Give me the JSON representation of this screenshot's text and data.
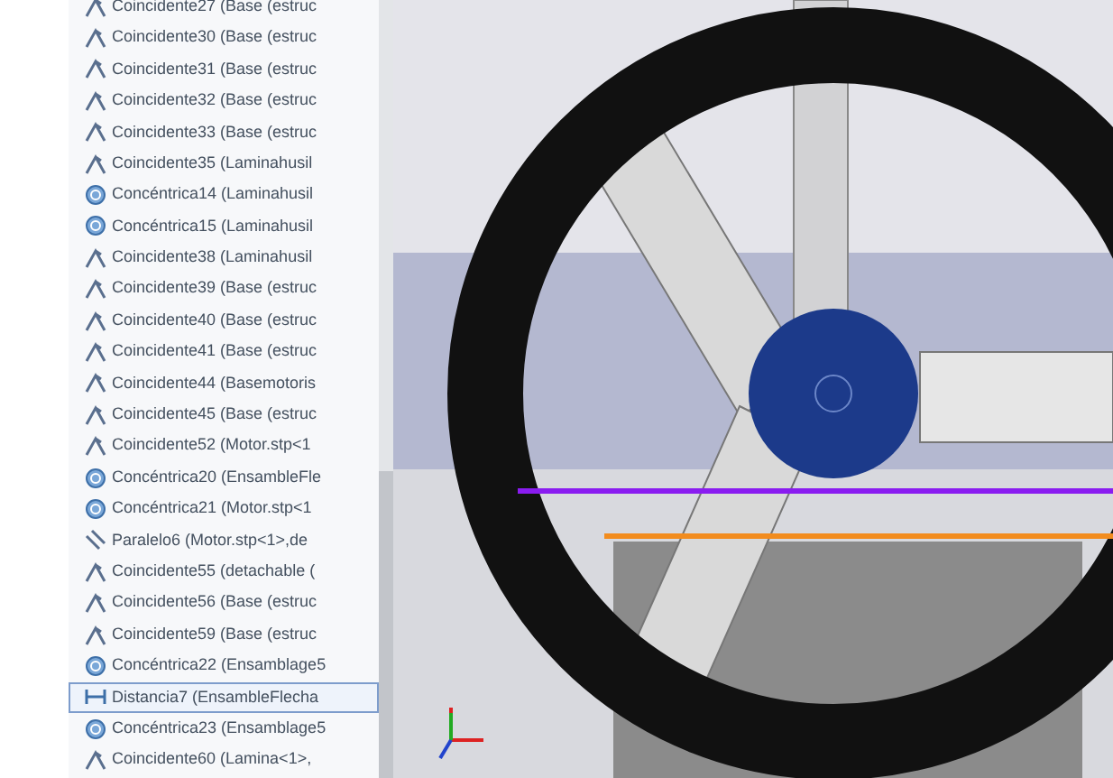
{
  "tree": {
    "items": [
      {
        "kind": "coincident",
        "label": "Coincidente27 (Base (estruc",
        "selected": false
      },
      {
        "kind": "coincident",
        "label": "Coincidente30 (Base (estruc",
        "selected": false
      },
      {
        "kind": "coincident",
        "label": "Coincidente31 (Base (estruc",
        "selected": false
      },
      {
        "kind": "coincident",
        "label": "Coincidente32 (Base (estruc",
        "selected": false
      },
      {
        "kind": "coincident",
        "label": "Coincidente33 (Base (estruc",
        "selected": false
      },
      {
        "kind": "coincident",
        "label": "Coincidente35 (Laminahusil",
        "selected": false
      },
      {
        "kind": "concentric",
        "label": "Concéntrica14 (Laminahusil",
        "selected": false
      },
      {
        "kind": "concentric",
        "label": "Concéntrica15 (Laminahusil",
        "selected": false
      },
      {
        "kind": "coincident",
        "label": "Coincidente38 (Laminahusil",
        "selected": false
      },
      {
        "kind": "coincident",
        "label": "Coincidente39 (Base (estruc",
        "selected": false
      },
      {
        "kind": "coincident",
        "label": "Coincidente40 (Base (estruc",
        "selected": false
      },
      {
        "kind": "coincident",
        "label": "Coincidente41 (Base (estruc",
        "selected": false
      },
      {
        "kind": "coincident",
        "label": "Coincidente44 (Basemotoris",
        "selected": false
      },
      {
        "kind": "coincident",
        "label": "Coincidente45 (Base (estruc",
        "selected": false
      },
      {
        "kind": "coincident",
        "label": "Coincidente52 (Motor.stp<1",
        "selected": false
      },
      {
        "kind": "concentric",
        "label": "Concéntrica20 (EnsambleFle",
        "selected": false
      },
      {
        "kind": "concentric",
        "label": "Concéntrica21 (Motor.stp<1",
        "selected": false
      },
      {
        "kind": "parallel",
        "label": "Paralelo6 (Motor.stp<1>,de",
        "selected": false
      },
      {
        "kind": "coincident",
        "label": "Coincidente55 (detachable (",
        "selected": false
      },
      {
        "kind": "coincident",
        "label": "Coincidente56 (Base (estruc",
        "selected": false
      },
      {
        "kind": "coincident",
        "label": "Coincidente59 (Base (estruc",
        "selected": false
      },
      {
        "kind": "concentric",
        "label": "Concéntrica22 (Ensamblage5",
        "selected": false
      },
      {
        "kind": "distance",
        "label": "Distancia7 (EnsambleFlecha",
        "selected": true
      },
      {
        "kind": "concentric",
        "label": "Concéntrica23 (Ensamblage5",
        "selected": false
      },
      {
        "kind": "coincident",
        "label": "Coincidente60 (Lamina<1>,",
        "selected": false
      }
    ]
  }
}
